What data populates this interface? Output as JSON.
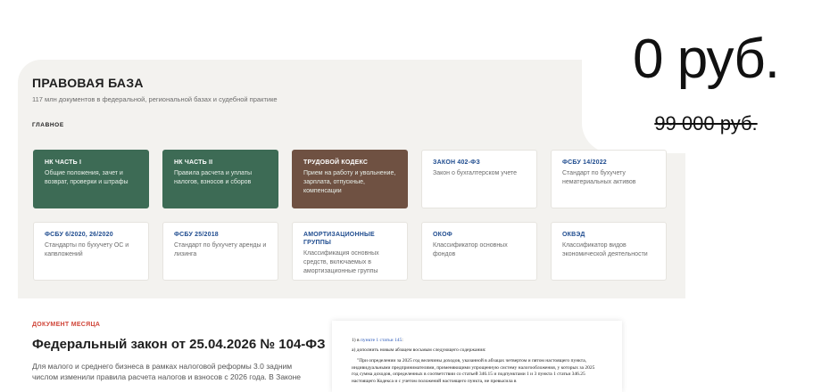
{
  "price": {
    "current": "0 руб.",
    "old": "99 000 руб."
  },
  "legal_base": {
    "title": "ПРАВОВАЯ БАЗА",
    "subtitle": "117 млн документов в федеральной, региональной базах и судебной практике",
    "section_label": "ГЛАВНОЕ",
    "cards": [
      {
        "title": "НК ЧАСТЬ I",
        "desc": "Общие положения, зачет и возврат, проверки и штрафы",
        "style": "green"
      },
      {
        "title": "НК ЧАСТЬ II",
        "desc": "Правила расчета и уплаты налогов, взносов и сборов",
        "style": "green"
      },
      {
        "title": "ТРУДОВОЙ КОДЕКС",
        "desc": "Прием на работу и увольнение, зарплата, отпускные, компенсации",
        "style": "brown"
      },
      {
        "title": "ЗАКОН 402-ФЗ",
        "desc": "Закон о бухгалтерском учете",
        "style": "white"
      },
      {
        "title": "ФСБУ 14/2022",
        "desc": "Стандарт по бухучету нематериальных активов",
        "style": "white"
      },
      {
        "title": "ФСБУ 6/2020, 26/2020",
        "desc": "Стандарты по бухучету ОС и капвложений",
        "style": "white"
      },
      {
        "title": "ФСБУ 25/2018",
        "desc": "Стандарт по бухучету аренды и лизинга",
        "style": "white"
      },
      {
        "title": "АМОРТИЗАЦИОННЫЕ ГРУППЫ",
        "desc": "Классификация основных средств, включаемых в амортизационные группы",
        "style": "white"
      },
      {
        "title": "ОКОФ",
        "desc": "Классификатор основных фондов",
        "style": "white"
      },
      {
        "title": "ОКВЭД",
        "desc": "Классификатор видов экономической деятельности",
        "style": "white"
      }
    ]
  },
  "doc_of_month": {
    "label": "ДОКУМЕНТ МЕСЯЦА",
    "title": "Федеральный закон от 25.04.2026 № 104-ФЗ",
    "body": "Для малого и среднего бизнеса в рамках налоговой реформы 3.0 задним числом изменили правила расчета налогов и взносов с 2026 года. В Законе"
  },
  "preview": {
    "line1_prefix": "1) в ",
    "line1_link": "пункте 1 статьи 145",
    "line1_suffix": ":",
    "line2": "а) дополнить новым абзацем восьмым следующего содержания:",
    "paragraph": "\"При определении за 2025 год величины доходов, указанной в абзацах четвертом и пятом настоящего пункта, индивидуальными предпринимателями, применяющими упрощенную систему налогообложения, у которых за 2025 год сумма доходов, определенных в соответствии со статьей 346.15 и подпунктами 1 и 3 пункта 1 статьи 346.25 настоящего Кодекса и с учетом положений настоящего пункта, не превысила в"
  }
}
